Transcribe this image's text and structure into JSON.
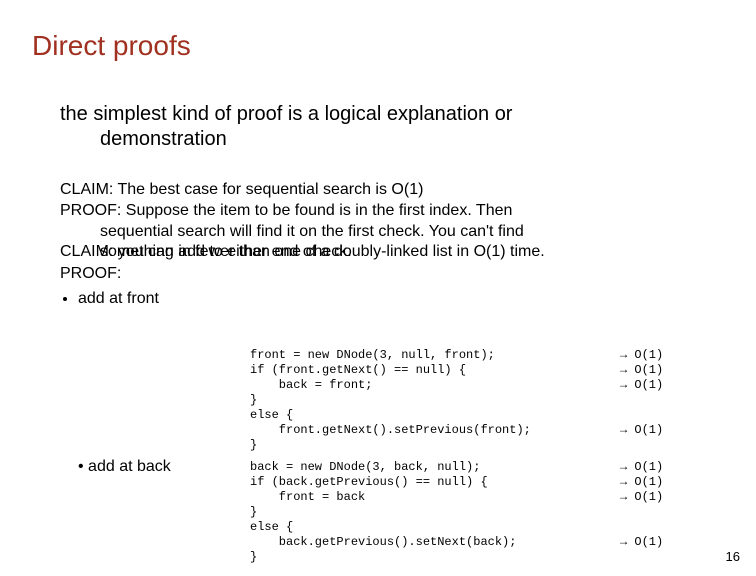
{
  "title": "Direct proofs",
  "intro_line1": "the simplest kind of proof is a logical explanation or",
  "intro_line2": "demonstration",
  "claim1": "CLAIM: The best case for sequential search is O(1)",
  "proof1_l1": "PROOF: Suppose the item to be found is in the first index.  Then",
  "proof1_l2": "sequential search will find it on the first check.  You can't find",
  "overlap_upper": "something in fewer than one check.",
  "overlap_lower": "CLAIM: you can add to either end of a doubly-linked list in O(1) time.",
  "proof2": "PROOF:",
  "bullet_front": "add at front",
  "bullet_back": "add at back",
  "code_front": "front = new DNode(3, null, front);\nif (front.getNext() == null) {\n    back = front;\n}\nelse {\n    front.getNext().setPrevious(front);\n}",
  "bigo_front": "→ O(1)\n→ O(1)\n→ O(1)\n\n\n→ O(1)",
  "code_back": "back = new DNode(3, back, null);\nif (back.getPrevious() == null) {\n    front = back\n}\nelse {\n    back.getPrevious().setNext(back);\n}",
  "bigo_back": "→ O(1)\n→ O(1)\n→ O(1)\n\n\n→ O(1)",
  "page_number": "16"
}
